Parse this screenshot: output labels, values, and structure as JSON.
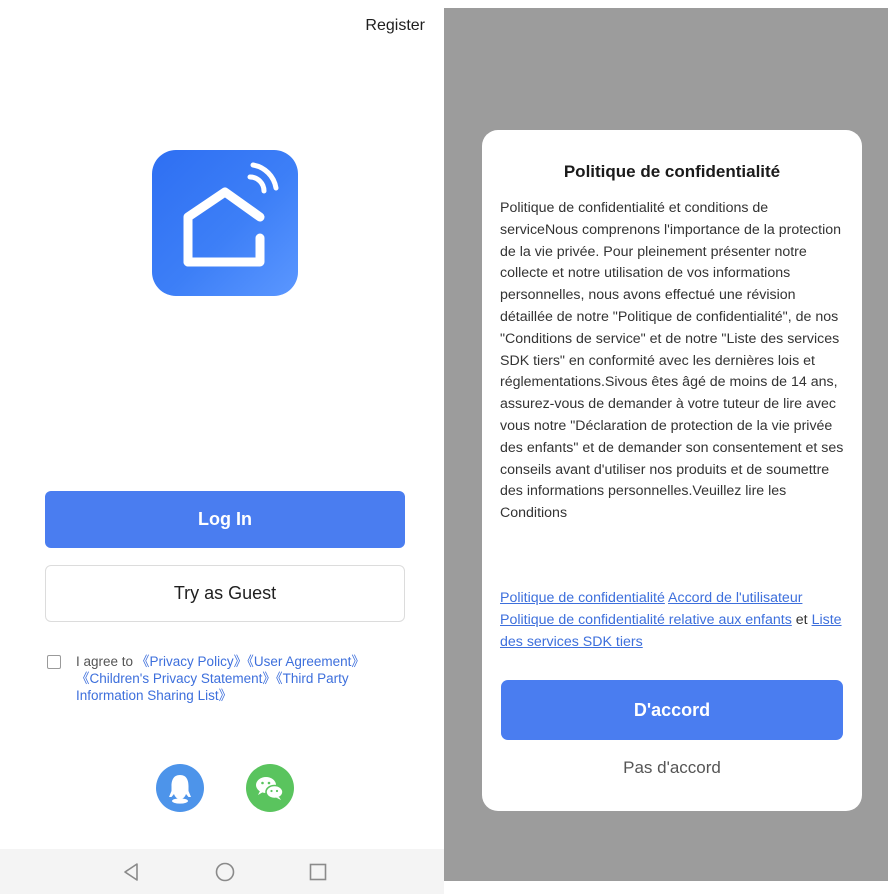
{
  "header": {
    "register_label": "Register"
  },
  "login": {
    "login_button": "Log In",
    "guest_button": "Try as Guest",
    "agree_prefix": "I agree to",
    "privacy_policy": "《Privacy Policy》",
    "user_agreement": "《User Agreement》",
    "children_privacy": "《Children's Privacy Statement》",
    "third_party": "《Third Party Information Sharing List》",
    "agree_checked": false
  },
  "social": {
    "icons": [
      "qq-icon",
      "wechat-icon"
    ]
  },
  "navbar": {
    "icons": [
      "back-icon",
      "home-icon",
      "recents-icon"
    ]
  },
  "dialog": {
    "title": "Politique de confidentialité",
    "body": "Politique de confidentialité et conditions de serviceNous comprenons l'importance de la protection de la vie privée. Pour pleinement présenter notre collecte et notre utilisation de vos informations personnelles, nous avons effectué une révision détaillée de notre \"Politique de confidentialité\", de nos \"Conditions de service\" et de notre \"Liste des services SDK tiers\" en conformité avec les dernières lois et réglementations.Sivous êtes âgé de moins de 14 ans, assurez-vous de demander à votre tuteur de lire avec vous notre \"Déclaration de protection de la vie privée des enfants\" et de demander son consentement et ses conseils avant d'utiliser nos produits et de soumettre des informations personnelles.Veuillez lire les Conditions",
    "link_privacy": "Politique de confidentialité",
    "link_user_agreement": "Accord de l'utilisateur",
    "link_children": "Politique de confidentialité relative aux enfants",
    "link_and": "et",
    "link_sdk": "Liste des services SDK tiers",
    "accept_button": "D'accord",
    "decline_button": "Pas d'accord"
  },
  "colors": {
    "accent": "#4a7df0",
    "link": "#3d6fdc",
    "overlay": "#9c9c9c",
    "qq": "#4d94ea",
    "wechat": "#5ac45e"
  }
}
